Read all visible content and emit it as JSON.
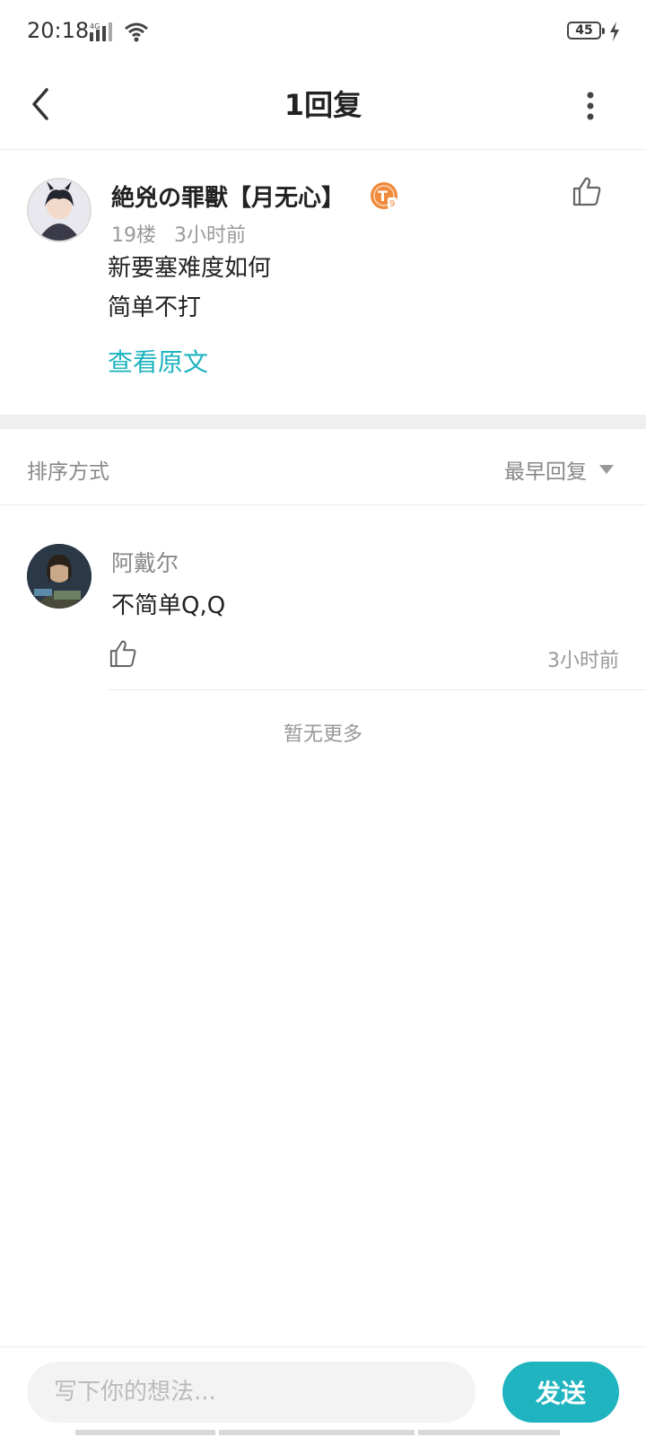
{
  "status_bar": {
    "time": "20:18",
    "network": "4G",
    "battery": "45"
  },
  "header": {
    "title": "1回复"
  },
  "post": {
    "author": "絶兇の罪獸【月无心】",
    "floor": "19楼",
    "time": "3小时前",
    "lines": [
      "新要塞难度如何",
      "简单不打"
    ],
    "view_original": "查看原文",
    "badge_letter": "T",
    "badge_level": "9"
  },
  "sort": {
    "label": "排序方式",
    "value": "最早回复"
  },
  "replies": [
    {
      "author": "阿戴尔",
      "text": "不简单Q,Q",
      "time": "3小时前"
    }
  ],
  "no_more": "暂无更多",
  "composer": {
    "placeholder": "写下你的想法...",
    "send_label": "发送"
  },
  "colors": {
    "accent": "#1fb4c0",
    "badge": "#f08a3c"
  }
}
